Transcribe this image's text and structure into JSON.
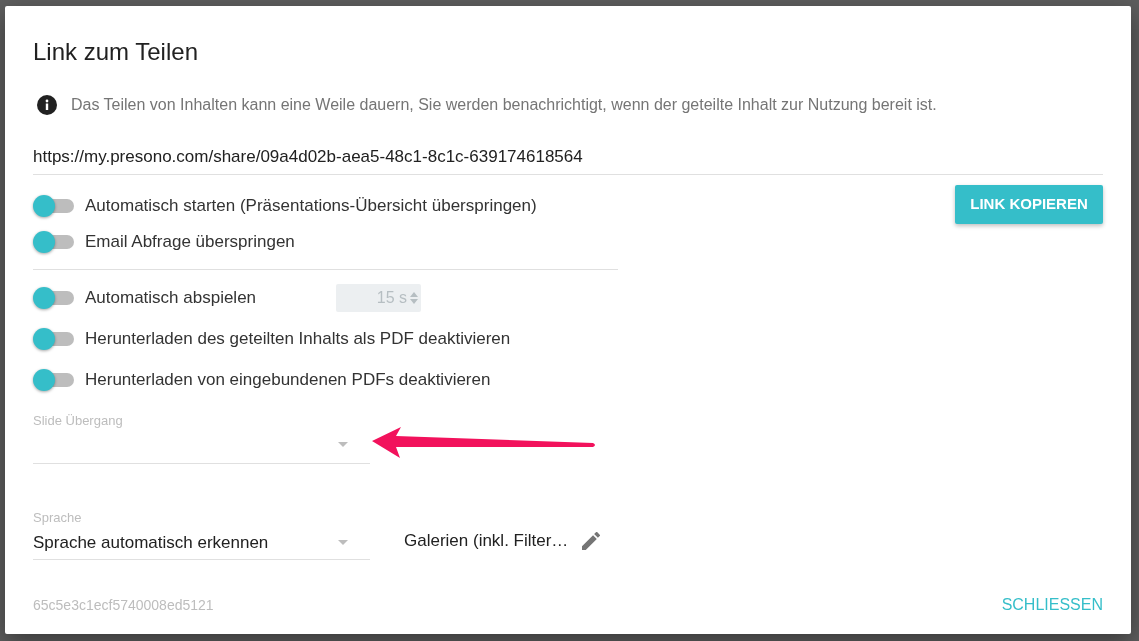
{
  "dialog": {
    "title": "Link zum Teilen"
  },
  "info": {
    "text": "Das Teilen von Inhalten kann eine Weile dauern, Sie werden benachrichtigt, wenn der geteilte Inhalt zur Nutzung bereit ist."
  },
  "share_link": {
    "value": "https://my.presono.com/share/09a4d02b-aea5-48c1-8c1c-639174618564"
  },
  "copy_button": {
    "label": "LINK KOPIEREN"
  },
  "start_options": [
    {
      "label": "Automatisch starten (Präsentations-Übersicht überspringen)",
      "on": false
    },
    {
      "label": "Email Abfrage überspringen",
      "on": false
    }
  ],
  "playback_options": [
    {
      "label": "Automatisch abspielen",
      "on": false,
      "interval": {
        "value": "15 s",
        "disabled": true
      }
    },
    {
      "label": "Herunterladen des geteilten Inhalts als PDF deaktivieren",
      "on": false
    },
    {
      "label": "Herunterladen von eingebundenen PDFs deaktivieren",
      "on": false
    }
  ],
  "slide_transition": {
    "label": "Slide Übergang"
  },
  "language": {
    "label": "Sprache",
    "value": "Sprache automatisch erkennen"
  },
  "galleries": {
    "label": "Galerien (inkl. Filter…"
  },
  "footer": {
    "id": "65c5e3c1ecf5740008ed5121",
    "close_button": "SCHLIESSEN"
  }
}
